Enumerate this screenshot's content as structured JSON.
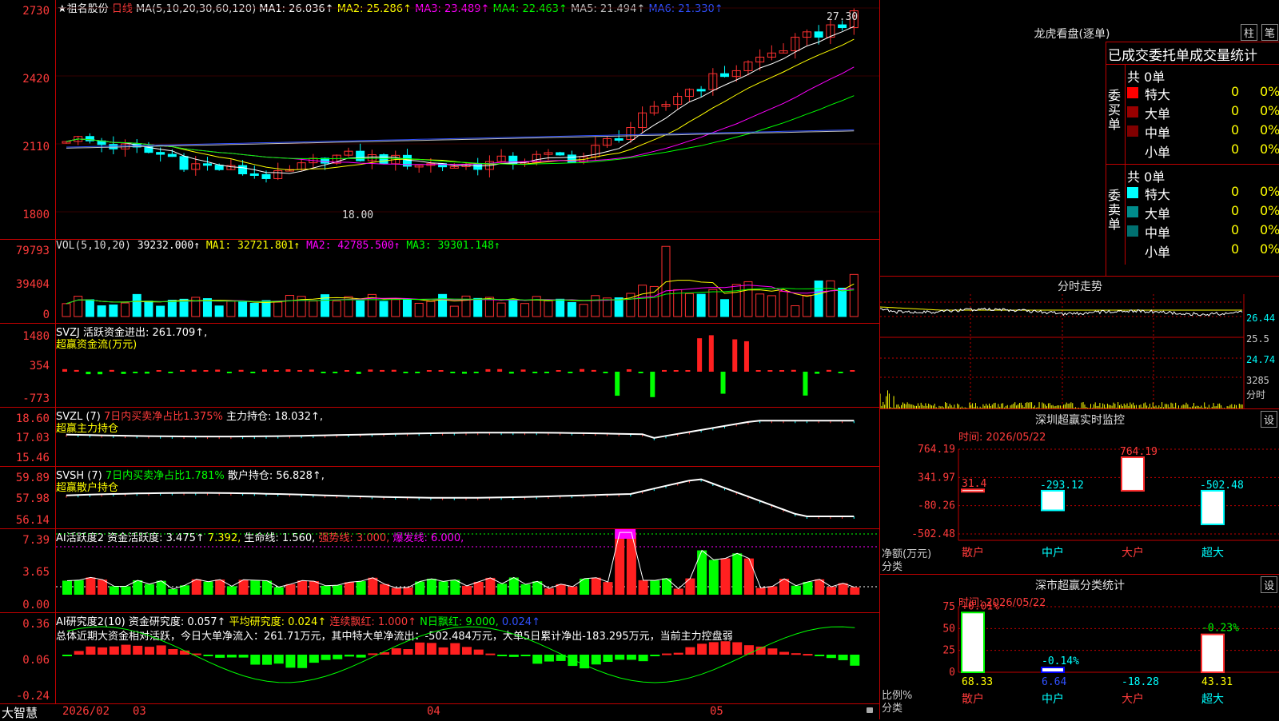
{
  "main": {
    "star": "★",
    "stock_name": "祖名股份",
    "period": "日线",
    "ma_header": "MA(5,10,20,30,60,120)",
    "ma_values": [
      {
        "label": "MA1: 26.036↑",
        "color": "#ffffff"
      },
      {
        "label": "MA2: 25.286↑",
        "color": "#ffff00"
      },
      {
        "label": "MA3: 23.489↑",
        "color": "#ff00ff"
      },
      {
        "label": "MA4: 22.463↑",
        "color": "#00ff00"
      },
      {
        "label": "MA5: 21.494↑",
        "color": "#c0c0c0"
      },
      {
        "label": "MA6: 21.330↑",
        "color": "#3050ff"
      }
    ],
    "y_ticks": [
      "2730",
      "2420",
      "2110",
      "1800"
    ],
    "high_label": "27.30",
    "low_label": "18.00"
  },
  "vol": {
    "header": "VOL(5,10,20)",
    "value": "39232.000↑",
    "ma": [
      {
        "label": "MA1: 32721.801↑",
        "color": "#ffff00"
      },
      {
        "label": "MA2: 42785.500↑",
        "color": "#ff00ff"
      },
      {
        "label": "MA3: 39301.148↑",
        "color": "#00ff00"
      }
    ],
    "y_ticks": [
      "79793",
      "39404",
      "0"
    ]
  },
  "svzj": {
    "line1": "SVZJ  活跃资金进出: 261.709↑,",
    "line2": "超赢资金流(万元)",
    "y_ticks": [
      "1480",
      "354",
      "-773"
    ]
  },
  "svzl": {
    "p1": "SVZL (7)",
    "p2": "7日内买卖净占比1.375%",
    "p3": "主力持仓: 18.032↑,",
    "line2": "超赢主力持仓",
    "y_ticks": [
      "18.60",
      "17.03",
      "15.46"
    ]
  },
  "svsh": {
    "p1": "SVSH (7)",
    "p2": "7日内买卖净占比1.781%",
    "p3": "散户持仓: 56.828↑,",
    "line2": "超赢散户持仓",
    "y_ticks": [
      "59.89",
      "57.98",
      "56.14"
    ]
  },
  "ai1": {
    "p1": "AI活跃度2",
    "p2": "资金活跃度: 3.475↑",
    "p3": "7.392,",
    "p4": "生命线: 1.560,",
    "p5": "强势线: 3.000,",
    "p6": "爆发线: 6.000,",
    "y_ticks": [
      "7.39",
      "3.65",
      "0.00"
    ]
  },
  "ai2": {
    "p1": "AI研究度2(10)",
    "p2": "资金研究度: 0.057↑",
    "p3": "平均研究度: 0.024↑",
    "p4": "连续飘红: 1.000↑",
    "p5": "N日飘红: 9.000,",
    "p6": "0.024↑",
    "summary": "总体近期大资金相对活跃，今日大单净流入：261.71万元，其中特大单净流出：-502.484万元，大单5日累计净出-183.295万元，当前主力控盘弱",
    "y_ticks": [
      "0.36",
      "0.06",
      "-0.24"
    ]
  },
  "bottom": {
    "brand": "大智慧",
    "dates": [
      "2026/02",
      "03",
      "04",
      "05"
    ]
  },
  "dragon": {
    "title": "龙虎看盘(逐单)",
    "btn_bar": "柱",
    "btn_pen": "笔",
    "tabs": "已成交委托单成交量统计",
    "buy_label": "委买单",
    "sell_label": "委卖单",
    "buy_total": "共 0单",
    "sell_total": "共 0单",
    "buy_rows": [
      {
        "name": "特大",
        "val": "0",
        "pct": "0%",
        "color": "#ff0000"
      },
      {
        "name": "大单",
        "val": "0",
        "pct": "0%",
        "color": "#990000"
      },
      {
        "name": "中单",
        "val": "0",
        "pct": "0%",
        "color": "#800000"
      },
      {
        "name": "小单",
        "val": "0",
        "pct": "0%",
        "color": "#000000"
      }
    ],
    "sell_rows": [
      {
        "name": "特大",
        "val": "0",
        "pct": "0%",
        "color": "#00ffff"
      },
      {
        "name": "大单",
        "val": "0",
        "pct": "0%",
        "color": "#008c8c"
      },
      {
        "name": "中单",
        "val": "0",
        "pct": "0%",
        "color": "#007070"
      },
      {
        "name": "小单",
        "val": "0",
        "pct": "0%",
        "color": "#000000"
      }
    ]
  },
  "intraday": {
    "title": "分时走势",
    "prices": [
      "26.44",
      "25.5",
      "24.74"
    ],
    "vol": "3285",
    "vol_unit": "分时"
  },
  "monitor": {
    "title": "深圳超赢实时监控",
    "btn": "设",
    "time": "时间: 2026/05/22",
    "y_ticks": [
      "764.19",
      "341.97",
      "-80.26",
      "-502.48"
    ],
    "unit": "净额(万元)",
    "unit2": "分类",
    "cats": [
      "散户",
      "中户",
      "大户",
      "超大"
    ]
  },
  "stats": {
    "title": "深市超赢分类统计",
    "btn": "设",
    "time": "时间: 2026/05/22",
    "y_ticks": [
      "75",
      "50",
      "25",
      "0"
    ],
    "unit": "比例%",
    "unit2": "分类",
    "cats": [
      "散户",
      "中户",
      "大户",
      "超大"
    ]
  },
  "chart_data": [
    {
      "type": "bar",
      "title": "深圳超赢实时监控",
      "ylabel": "净额(万元)",
      "categories": [
        "散户",
        "中户",
        "大户",
        "超大"
      ],
      "values": [
        31.4,
        -293.12,
        764.19,
        -502.48
      ],
      "ylim": [
        -502.48,
        764.19
      ]
    },
    {
      "type": "bar",
      "title": "深市超赢分类统计",
      "ylabel": "比例%",
      "categories": [
        "散户",
        "中户",
        "大户",
        "超大"
      ],
      "values": [
        68.33,
        6.64,
        -18.28,
        43.31
      ],
      "change_labels": [
        "+0.01%",
        "-0.14%",
        "",
        "-0.23%"
      ],
      "ylim": [
        0,
        75
      ]
    }
  ],
  "colors": {
    "up": "#ff3030",
    "down": "#00ffff",
    "grid": "#c00000",
    "accent": "#ffff00"
  }
}
